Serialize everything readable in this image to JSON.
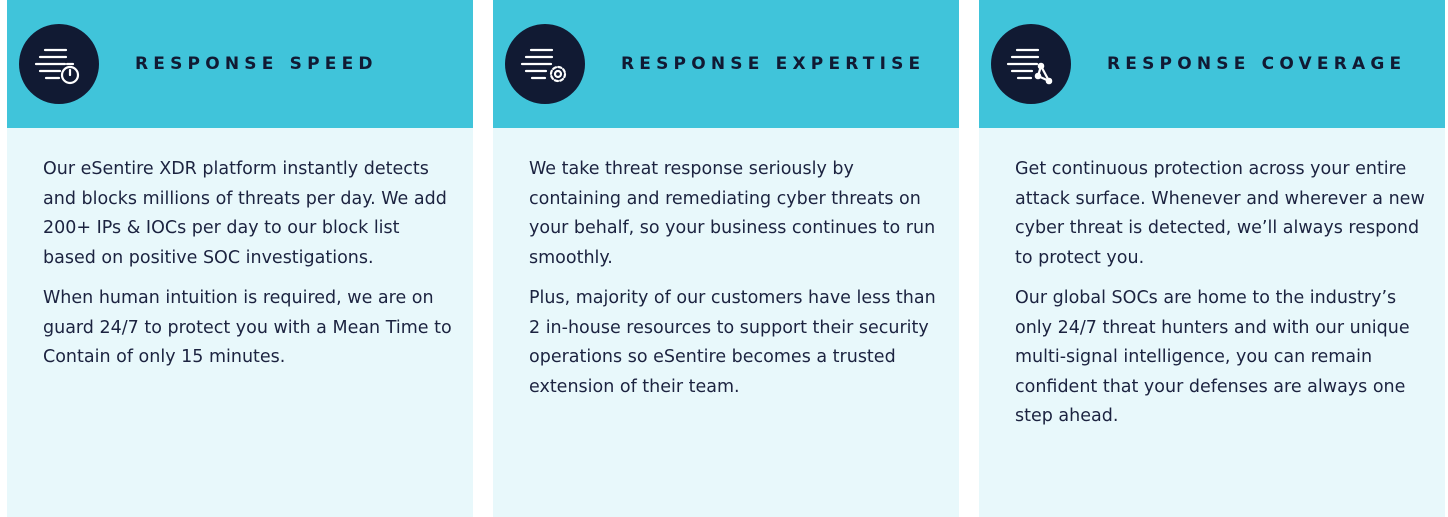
{
  "cards": [
    {
      "title": "RESPONSE SPEED",
      "icon": "speed-stopwatch-icon",
      "paragraphs": [
        "Our eSentire XDR platform instantly detects and blocks millions of threats per day. We add 200+ IPs & IOCs per day to our block list based on positive SOC investigations.",
        "When human intuition is required, we are on guard 24/7 to protect you with a Mean Time to Contain of only 15 minutes."
      ]
    },
    {
      "title": "RESPONSE EXPERTISE",
      "icon": "speed-gear-icon",
      "paragraphs": [
        "We take threat response seriously by containing and remediating cyber threats on your behalf, so your business continues to run smoothly.",
        "Plus, majority of our customers have less than 2 in-house resources to support their security operations so eSentire becomes a trusted extension of their team."
      ]
    },
    {
      "title": "RESPONSE COVERAGE",
      "icon": "speed-network-icon",
      "paragraphs": [
        "Get continuous protection across your entire attack surface. Whenever and wherever a new cyber threat is detected, we’ll always respond to protect you.",
        "Our global SOCs are home to the industry’s only 24/7 threat hunters and with our unique multi-signal intelligence, you can remain confident that your defenses are always one step ahead."
      ]
    }
  ],
  "colors": {
    "header": "#40c4da",
    "body": "#e8f8fb",
    "navy": "#111a33",
    "text": "#1c2340"
  }
}
